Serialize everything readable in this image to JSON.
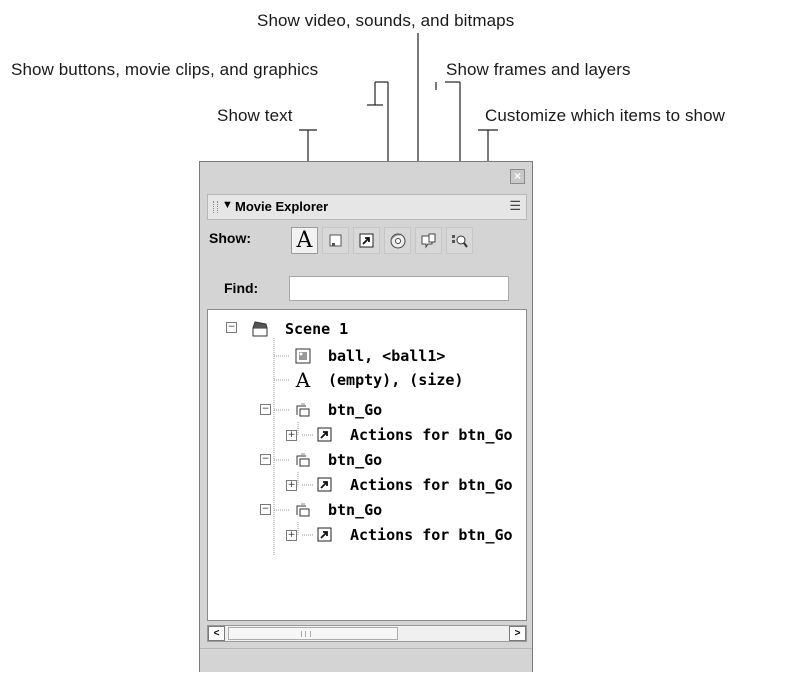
{
  "callouts": {
    "video": "Show video, sounds, and bitmaps",
    "buttons": "Show buttons, movie clips, and graphics",
    "frames": "Show frames and layers",
    "text": "Show text",
    "customize": "Customize which items to show"
  },
  "panel": {
    "title": "Movie Explorer",
    "show_label": "Show:",
    "find_label": "Find:",
    "find_value": ""
  },
  "tree": {
    "scene": "Scene 1",
    "items": [
      {
        "label": "ball, <ball1>",
        "icon": "bitmap-icon"
      },
      {
        "label": "(empty), (size)",
        "icon": "text-icon"
      },
      {
        "label": "btn_Go",
        "icon": "button-symbol-icon"
      },
      {
        "label": "Actions for btn_Go",
        "icon": "actions-icon"
      },
      {
        "label": "btn_Go",
        "icon": "button-symbol-icon"
      },
      {
        "label": "Actions for btn_Go",
        "icon": "actions-icon"
      },
      {
        "label": "btn_Go",
        "icon": "button-symbol-icon"
      },
      {
        "label": "Actions for btn_Go",
        "icon": "actions-icon"
      }
    ]
  }
}
